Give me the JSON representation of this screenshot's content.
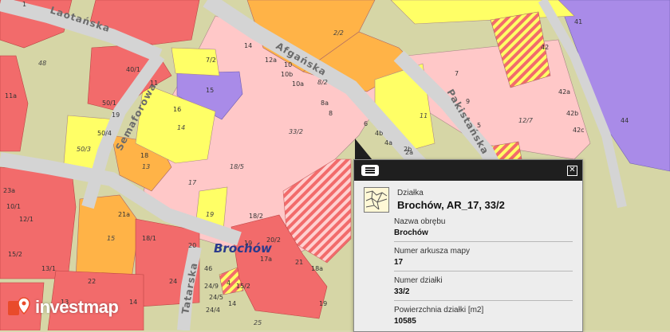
{
  "map": {
    "streets": [
      "Laotańska",
      "Afgańska",
      "Semaforowa",
      "Pakistańska",
      "Tatarska"
    ],
    "district": "Brochów",
    "plots": [
      "1",
      "41",
      "48",
      "40/1",
      "11",
      "11a",
      "50/1",
      "19",
      "50/4",
      "50/3",
      "7/2",
      "16",
      "14",
      "15",
      "18",
      "13",
      "23a",
      "10/1",
      "12/1",
      "15/2",
      "13/1",
      "18/1",
      "21a",
      "15",
      "19",
      "18/5",
      "17",
      "14",
      "12a",
      "10",
      "10b",
      "10a",
      "8/2",
      "8a",
      "8",
      "2/2",
      "33/2",
      "6",
      "4b",
      "4a",
      "2a",
      "11",
      "9",
      "7",
      "5",
      "12/7",
      "42",
      "42a",
      "42b",
      "42c",
      "44",
      "20",
      "22",
      "24",
      "46",
      "24/9",
      "24/5",
      "25",
      "13",
      "14",
      "21",
      "19",
      "17a",
      "20/2",
      "18a",
      "18/2",
      "19",
      "4",
      "15/2",
      "14",
      "24/4",
      "2b"
    ]
  },
  "popup": {
    "object_type": "Działka",
    "object_title": "Brochów, AR_17, 33/2",
    "fields": [
      {
        "label": "Nazwa obrębu",
        "value": "Brochów"
      },
      {
        "label": "Numer arkusza mapy",
        "value": "17"
      },
      {
        "label": "Numer działki",
        "value": "33/2"
      },
      {
        "label": "Powierzchnia działki [m2]",
        "value": "10585"
      }
    ],
    "icons": {
      "list": "list-icon",
      "close": "close-icon",
      "object": "map-parcel-icon"
    }
  },
  "logo": {
    "text": "investmap"
  },
  "colors": {
    "residential_pink": "#ffc8c8",
    "red": "#f26b6b",
    "yellow": "#ffff66",
    "orange": "#ffb347",
    "purple": "#a98be8",
    "olive": "#dcdcaa"
  }
}
